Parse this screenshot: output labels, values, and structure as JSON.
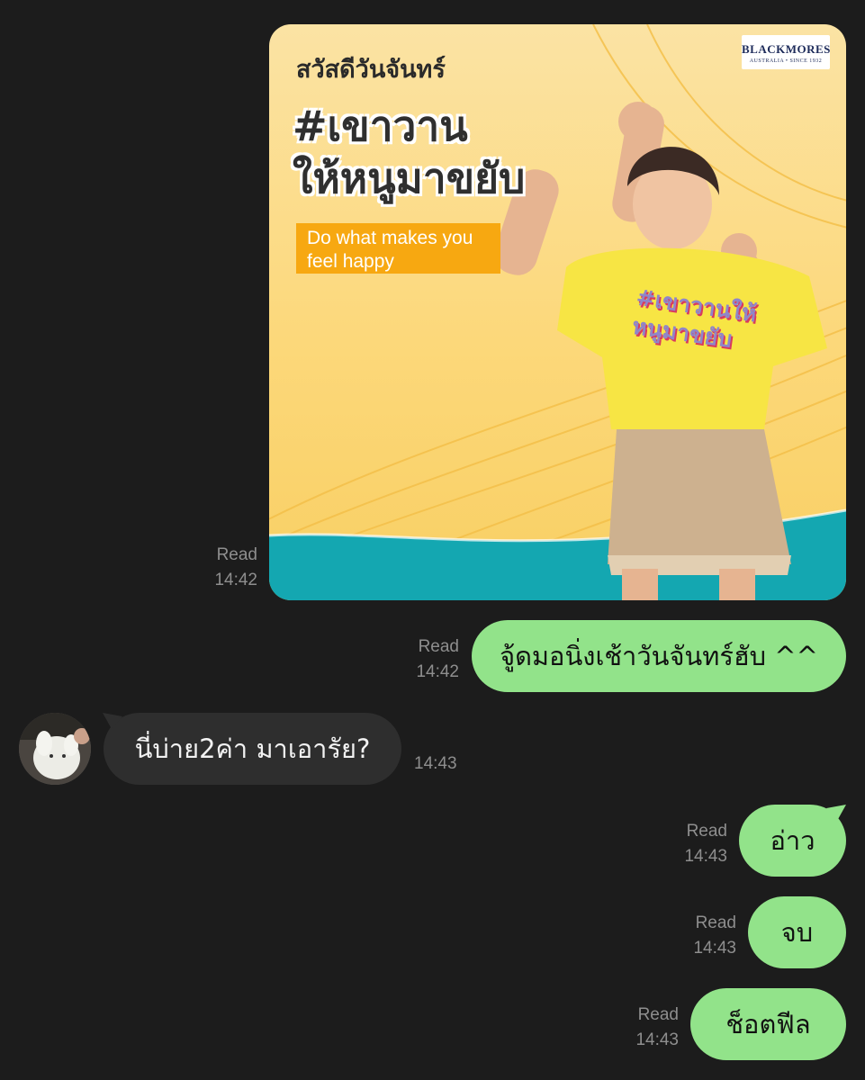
{
  "poster": {
    "greeting": "สวัสดีวันจันทร์",
    "title_line1": "#เขาวาน",
    "title_line2": "ให้หนูมาขยับ",
    "tagline_line1": "Do what makes you",
    "tagline_line2": "feel happy",
    "brand_name": "BLACKMORES",
    "brand_sub": "AUSTRALIA • SINCE 1932",
    "shirt_line1": "#เขาวานให้",
    "shirt_line2": "หนูมาขยับ"
  },
  "messages": [
    {
      "id": "m1",
      "direction": "outgoing",
      "kind": "image",
      "read_label": "Read",
      "time": "14:42"
    },
    {
      "id": "m2",
      "direction": "outgoing",
      "kind": "text",
      "text": "จู้ดมอนิ่งเช้าวันจันทร์ฮับ ^^",
      "read_label": "Read",
      "time": "14:42"
    },
    {
      "id": "m3",
      "direction": "incoming",
      "kind": "text",
      "text": "นี่บ่าย2ค่า มาเอารัย?",
      "time": "14:43"
    },
    {
      "id": "m4",
      "direction": "outgoing",
      "kind": "text",
      "text": "อ่าว",
      "read_label": "Read",
      "time": "14:43"
    },
    {
      "id": "m5",
      "direction": "outgoing",
      "kind": "text",
      "text": "จบ",
      "read_label": "Read",
      "time": "14:43"
    },
    {
      "id": "m6",
      "direction": "outgoing",
      "kind": "text",
      "text": "ช็อตฟีล",
      "read_label": "Read",
      "time": "14:43"
    }
  ],
  "colors": {
    "background": "#1c1c1c",
    "outgoing_bubble": "#92e38a",
    "incoming_bubble": "#2e2e2e",
    "meta_text": "#8e8e8e",
    "poster_teal": "#14a7b1",
    "poster_orange": "#f7a811"
  },
  "icons": {
    "avatar": "contact-avatar"
  }
}
